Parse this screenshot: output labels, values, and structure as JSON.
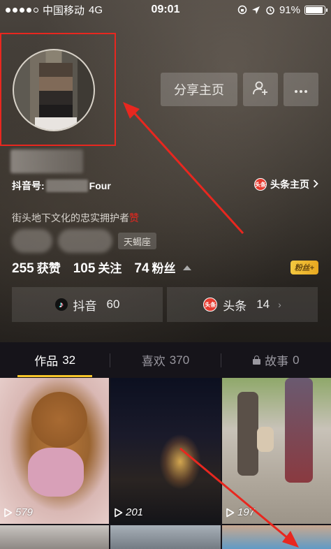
{
  "status_bar": {
    "carrier": "中国移动",
    "network": "4G",
    "time": "09:01",
    "battery": "91%",
    "battery_level": 0.91
  },
  "header": {
    "share_button": "分享主页",
    "add_friend_icon": "add-user-icon",
    "more_icon": "more-dots-icon"
  },
  "profile": {
    "account_label": "抖音号:",
    "account_suffix": "Four",
    "toutiao_badge": "头条",
    "toutiao_link": "头条主页",
    "bio": "街头地下文化的忠实拥护者",
    "bio_icon": "赞",
    "tag": "天蝎座"
  },
  "stats": {
    "likes_num": "255",
    "likes_label": "获赞",
    "following_num": "105",
    "following_label": "关注",
    "fans_num": "74",
    "fans_label": "粉丝",
    "fans_badge": "粉丝+"
  },
  "platforms": [
    {
      "label": "抖音",
      "count": "60"
    },
    {
      "label": "头条",
      "count": "14",
      "badge": "头条"
    }
  ],
  "tabs": [
    {
      "label": "作品",
      "count": "32"
    },
    {
      "label": "喜欢",
      "count": "370"
    },
    {
      "label": "故事",
      "count": "0"
    }
  ],
  "videos": [
    {
      "count": "579"
    },
    {
      "count": "201"
    },
    {
      "count": "197"
    }
  ],
  "colors": {
    "accent": "#f6c62a",
    "highlight": "#e8271f",
    "toutiao": "#e63a2e"
  }
}
